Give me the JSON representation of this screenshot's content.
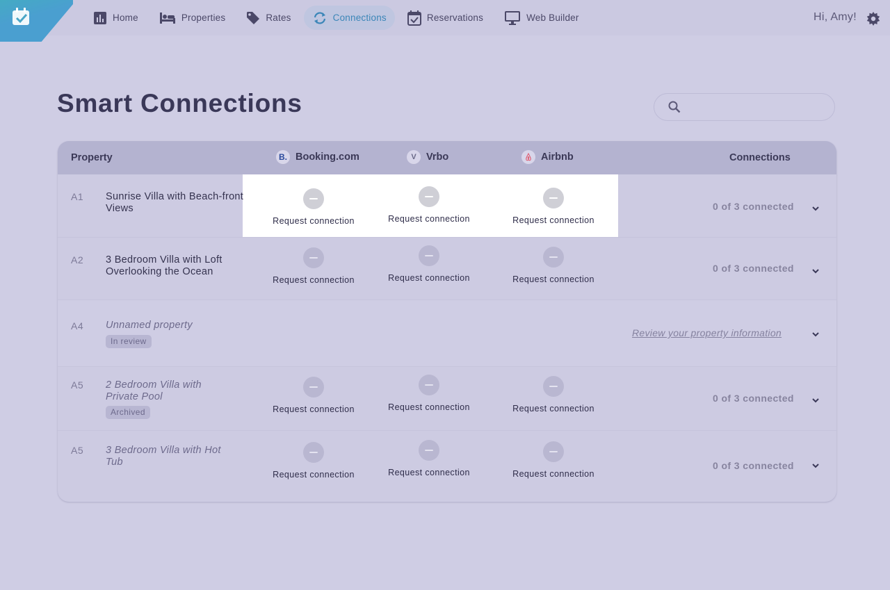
{
  "nav": {
    "items": [
      {
        "label": "Home",
        "icon": "bar-chart-icon"
      },
      {
        "label": "Properties",
        "icon": "bed-icon"
      },
      {
        "label": "Rates",
        "icon": "tag-icon"
      },
      {
        "label": "Connections",
        "icon": "sync-icon",
        "active": true
      },
      {
        "label": "Reservations",
        "icon": "calendar-check-icon"
      },
      {
        "label": "Web Builder",
        "icon": "monitor-icon"
      }
    ],
    "greeting": "Hi, Amy!"
  },
  "page": {
    "title": "Smart Connections",
    "search_placeholder": ""
  },
  "table": {
    "headers": {
      "property": "Property",
      "channel1": "Booking.com",
      "channel1_icon": "B.",
      "channel2": "Vrbo",
      "channel2_icon": "V",
      "channel3": "Airbnb",
      "channel3_icon": "airbnb-icon",
      "connections": "Connections"
    },
    "rows": [
      {
        "code": "A1",
        "name": "Sunrise Villa with Beach-front Views",
        "c1": "Request connection",
        "c2": "Request connection",
        "c3": "Request connection",
        "status": "0 of 3 connected"
      },
      {
        "code": "A2",
        "name": "3 Bedroom Villa with Loft Overlooking the Ocean",
        "c1": "Request connection",
        "c2": "Request connection",
        "c3": "Request connection",
        "status": "0 of 3 connected"
      },
      {
        "code": "A4",
        "name": "Unnamed property",
        "badge": "In review",
        "review_link": "Review your property information"
      },
      {
        "code": "A5",
        "name": "2 Bedroom Villa with Private Pool",
        "badge": "Archived",
        "c1": "Request connection",
        "c2": "Request connection",
        "c3": "Request connection",
        "status": "0 of 3 connected"
      },
      {
        "code": "A5",
        "name": "3 Bedroom Villa with Hot Tub",
        "c1": "Request connection",
        "c2": "Request connection",
        "c3": "Request connection",
        "status": "0 of 3 connected"
      }
    ]
  },
  "colors": {
    "background": "#cfcde4",
    "header": "#b4b3d0",
    "accent": "#3b86b8",
    "logo": "#3cbcb0"
  }
}
